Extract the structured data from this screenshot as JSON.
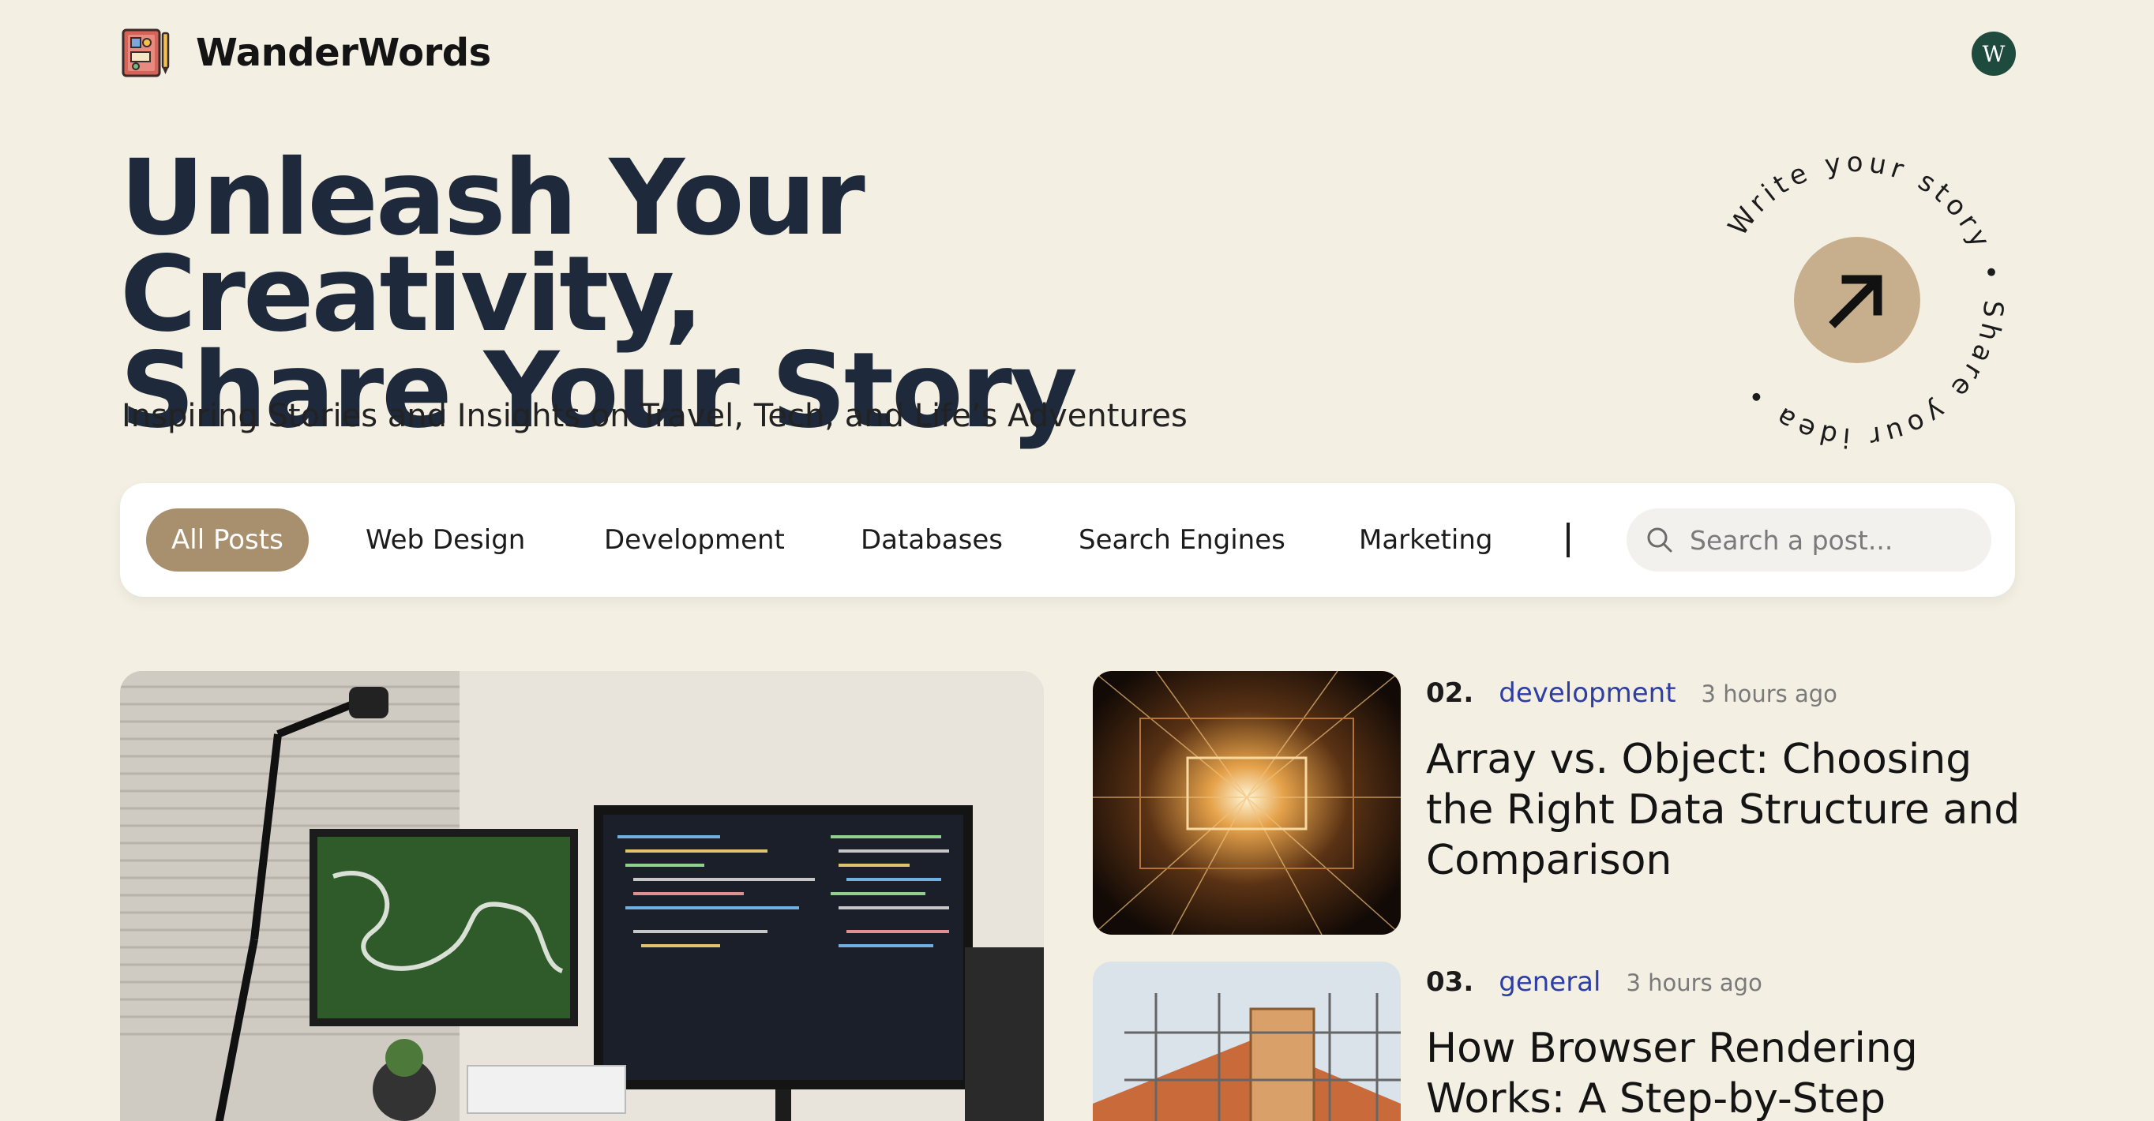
{
  "site": {
    "name": "WanderWords",
    "avatar_initial": "W"
  },
  "hero": {
    "title_line1": "Unleash Your Creativity,",
    "title_line2": "Share Your Story",
    "subtitle": "Inspiring Stories and Insights on Travel, Tech, and Life’s Adventures",
    "badge_text": "Write your story • Share your idea •"
  },
  "categories": {
    "items": [
      "All Posts",
      "Web Design",
      "Development",
      "Databases",
      "Search Engines",
      "Marketing"
    ],
    "active": "All Posts",
    "search_placeholder": "Search a post..."
  },
  "posts": [
    {
      "number": "02.",
      "category": "development",
      "time": "3 hours ago",
      "title": "Array vs. Object: Choosing the Right Data Structure and Comparison"
    },
    {
      "number": "03.",
      "category": "general",
      "time": "3 hours ago",
      "title": "How Browser Rendering Works: A Step-by-Step"
    }
  ],
  "colors": {
    "background": "#f3efe3",
    "accent": "#a8906e",
    "badge": "#c7af8e",
    "category_link": "#2d3ea4",
    "avatar": "#1f4a3e"
  }
}
